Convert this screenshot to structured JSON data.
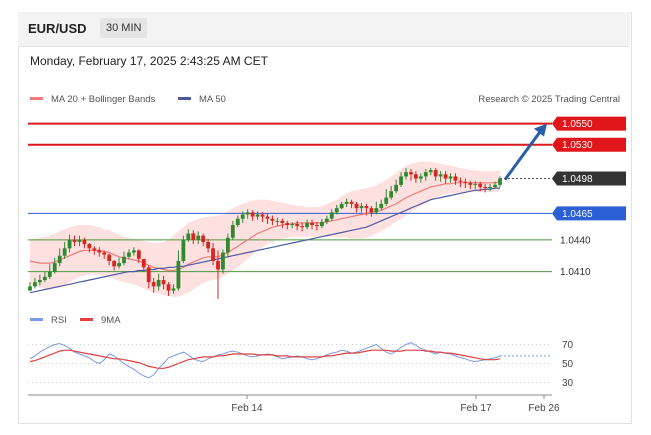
{
  "header": {
    "pair": "EUR/USD",
    "timeframe": "30 MIN"
  },
  "timestamp": "Monday, February 17, 2025 2:43:25 AM CET",
  "legend": {
    "ma20_label": "MA 20 + Bollinger Bands",
    "ma50_label": "MA 50",
    "copyright": "Research © 2025 Trading Central",
    "rsi_label": "RSI",
    "rsi_ma_label": "9MA"
  },
  "colors": {
    "resistance": "#e0161b",
    "current": "#333333",
    "support_strong": "#2a5fd6",
    "support": "#4a9a3b",
    "candle_up": "#2f8a2f",
    "candle_down": "#d8251f",
    "ma20": "#f07b7b",
    "ma50": "#4b5aa0",
    "band_fill": "#fde0e0",
    "arrow": "#2a5fa8",
    "rsi": "#7b9be0",
    "rsi_ma": "#e04040"
  },
  "chart_data": [
    {
      "type": "candlestick",
      "ylim": [
        1.0385,
        1.056
      ],
      "x_ticks": [
        "Feb 14",
        "Feb 17",
        "Feb 26"
      ],
      "levels": [
        {
          "value": 1.055,
          "label": "1.0550",
          "kind": "resistance"
        },
        {
          "value": 1.053,
          "label": "1.0530",
          "kind": "resistance"
        },
        {
          "value": 1.0498,
          "label": "1.0498",
          "kind": "current"
        },
        {
          "value": 1.0465,
          "label": "1.0465",
          "kind": "support_strong"
        },
        {
          "value": 1.044,
          "label": "1.0440",
          "kind": "support"
        },
        {
          "value": 1.041,
          "label": "1.0410",
          "kind": "support"
        }
      ],
      "series": [
        {
          "name": "MA 20 + Bollinger Bands"
        },
        {
          "name": "MA 50"
        }
      ],
      "close": [
        1.0396,
        1.04,
        1.0402,
        1.0405,
        1.041,
        1.0418,
        1.0425,
        1.0432,
        1.044,
        1.0438,
        1.044,
        1.0436,
        1.0432,
        1.043,
        1.0428,
        1.0426,
        1.042,
        1.0415,
        1.0418,
        1.0424,
        1.0428,
        1.043,
        1.0422,
        1.0414,
        1.04,
        1.0396,
        1.0402,
        1.0398,
        1.0392,
        1.0394,
        1.042,
        1.044,
        1.0446,
        1.044,
        1.0444,
        1.0438,
        1.0432,
        1.042,
        1.0412,
        1.0428,
        1.0442,
        1.0454,
        1.046,
        1.0464,
        1.0466,
        1.0462,
        1.0464,
        1.0462,
        1.046,
        1.0458,
        1.0458,
        1.0456,
        1.0454,
        1.0455,
        1.0453,
        1.0452,
        1.0456,
        1.0454,
        1.0453,
        1.0457,
        1.046,
        1.0466,
        1.047,
        1.0474,
        1.0476,
        1.0474,
        1.047,
        1.0472,
        1.047,
        1.0466,
        1.047,
        1.0474,
        1.048,
        1.0486,
        1.0492,
        1.05,
        1.0504,
        1.0502,
        1.0498,
        1.05,
        1.0504,
        1.0506,
        1.05,
        1.0502,
        1.0498,
        1.05,
        1.0496,
        1.0495,
        1.0494,
        1.0492,
        1.0493,
        1.049,
        1.0489,
        1.049,
        1.0492,
        1.0498
      ],
      "high": [
        1.04,
        1.0404,
        1.0407,
        1.041,
        1.0417,
        1.0423,
        1.0432,
        1.0438,
        1.0445,
        1.0444,
        1.0444,
        1.0442,
        1.0437,
        1.0434,
        1.0433,
        1.043,
        1.0427,
        1.0421,
        1.0423,
        1.0429,
        1.0431,
        1.0433,
        1.0431,
        1.0421,
        1.0416,
        1.0404,
        1.0408,
        1.0406,
        1.04,
        1.0398,
        1.043,
        1.0444,
        1.045,
        1.0449,
        1.0448,
        1.0446,
        1.0441,
        1.0437,
        1.043,
        1.0431,
        1.0446,
        1.0458,
        1.0463,
        1.0467,
        1.0469,
        1.0468,
        1.0467,
        1.0466,
        1.0465,
        1.0463,
        1.0461,
        1.046,
        1.0458,
        1.0457,
        1.0458,
        1.0456,
        1.0459,
        1.0459,
        1.0457,
        1.046,
        1.0463,
        1.0469,
        1.0473,
        1.0476,
        1.0479,
        1.0478,
        1.0476,
        1.0475,
        1.0474,
        1.0472,
        1.0476,
        1.0478,
        1.0488,
        1.0491,
        1.0497,
        1.0504,
        1.0508,
        1.0507,
        1.0505,
        1.0503,
        1.0507,
        1.0508,
        1.0508,
        1.0505,
        1.0505,
        1.0503,
        1.0503,
        1.0499,
        1.0498,
        1.0496,
        1.0496,
        1.0495,
        1.0493,
        1.0493,
        1.0495,
        1.05
      ],
      "low": [
        1.0392,
        1.0394,
        1.0397,
        1.04,
        1.0403,
        1.0408,
        1.0415,
        1.0422,
        1.0428,
        1.0434,
        1.0434,
        1.0432,
        1.0428,
        1.0426,
        1.0424,
        1.0422,
        1.0416,
        1.0411,
        1.0413,
        1.0416,
        1.0422,
        1.0425,
        1.0418,
        1.041,
        1.0394,
        1.039,
        1.0392,
        1.0393,
        1.0387,
        1.0389,
        1.0392,
        1.0418,
        1.0438,
        1.0436,
        1.0436,
        1.0434,
        1.0428,
        1.0416,
        1.0384,
        1.0408,
        1.0424,
        1.044,
        1.0452,
        1.0456,
        1.046,
        1.0458,
        1.0459,
        1.0457,
        1.0455,
        1.0454,
        1.0453,
        1.0451,
        1.045,
        1.0451,
        1.0449,
        1.0448,
        1.045,
        1.045,
        1.0449,
        1.0451,
        1.0455,
        1.0458,
        1.0464,
        1.0469,
        1.0471,
        1.047,
        1.0466,
        1.0466,
        1.0463,
        1.0462,
        1.0464,
        1.0468,
        1.0472,
        1.0478,
        1.0484,
        1.049,
        1.0497,
        1.0496,
        1.0494,
        1.0494,
        1.0496,
        1.0501,
        1.0496,
        1.0495,
        1.0493,
        1.0494,
        1.0492,
        1.049,
        1.0489,
        1.0488,
        1.0488,
        1.0486,
        1.0485,
        1.0486,
        1.0488,
        1.049
      ],
      "ma20": [
        1.042,
        1.0419,
        1.0418,
        1.0418,
        1.0418,
        1.0419,
        1.0421,
        1.0423,
        1.0425,
        1.0427,
        1.0429,
        1.043,
        1.043,
        1.043,
        1.043,
        1.0429,
        1.0428,
        1.0426,
        1.0424,
        1.0423,
        1.0422,
        1.0421,
        1.042,
        1.0418,
        1.0416,
        1.0414,
        1.0413,
        1.0412,
        1.0411,
        1.0411,
        1.0412,
        1.0414,
        1.0417,
        1.0419,
        1.0421,
        1.0423,
        1.0424,
        1.0424,
        1.0424,
        1.0426,
        1.0428,
        1.0431,
        1.0434,
        1.0437,
        1.044,
        1.0443,
        1.0446,
        1.0448,
        1.045,
        1.0452,
        1.0453,
        1.0454,
        1.0455,
        1.0455,
        1.0456,
        1.0456,
        1.0456,
        1.0456,
        1.0456,
        1.0456,
        1.0457,
        1.0458,
        1.0459,
        1.046,
        1.0461,
        1.0462,
        1.0463,
        1.0464,
        1.0465,
        1.0466,
        1.0467,
        1.0468,
        1.047,
        1.0472,
        1.0474,
        1.0477,
        1.048,
        1.0482,
        1.0484,
        1.0486,
        1.0488,
        1.049,
        1.0491,
        1.0492,
        1.0493,
        1.0493,
        1.0494,
        1.0494,
        1.0494,
        1.0494,
        1.0494,
        1.0494,
        1.0494,
        1.0494,
        1.0494,
        1.0495
      ],
      "bb_upper": [
        1.044,
        1.0441,
        1.0442,
        1.0443,
        1.0444,
        1.0446,
        1.0448,
        1.045,
        1.0452,
        1.0453,
        1.0454,
        1.0454,
        1.0454,
        1.0453,
        1.0452,
        1.045,
        1.0449,
        1.0447,
        1.0445,
        1.0443,
        1.0442,
        1.0441,
        1.044,
        1.0439,
        1.0438,
        1.0437,
        1.0437,
        1.0438,
        1.044,
        1.0444,
        1.0448,
        1.0452,
        1.0456,
        1.0458,
        1.046,
        1.0461,
        1.0462,
        1.0462,
        1.0463,
        1.0464,
        1.0467,
        1.047,
        1.0472,
        1.0474,
        1.0476,
        1.0477,
        1.0478,
        1.0478,
        1.0478,
        1.0477,
        1.0476,
        1.0475,
        1.0474,
        1.0473,
        1.0472,
        1.0472,
        1.0471,
        1.0471,
        1.0471,
        1.0472,
        1.0474,
        1.0476,
        1.0478,
        1.0481,
        1.0484,
        1.0486,
        1.0487,
        1.0488,
        1.0489,
        1.049,
        1.0492,
        1.0494,
        1.0497,
        1.05,
        1.0503,
        1.0507,
        1.051,
        1.0512,
        1.0513,
        1.0514,
        1.0514,
        1.0514,
        1.0513,
        1.0512,
        1.0511,
        1.051,
        1.0509,
        1.0508,
        1.0507,
        1.0506,
        1.0506,
        1.0505,
        1.0505,
        1.0505,
        1.0505,
        1.0506
      ],
      "bb_lower": [
        1.0398,
        1.0396,
        1.0395,
        1.0394,
        1.0394,
        1.0394,
        1.0395,
        1.0397,
        1.04,
        1.0403,
        1.0405,
        1.0406,
        1.0407,
        1.0407,
        1.0407,
        1.0406,
        1.0405,
        1.0403,
        1.0401,
        1.04,
        1.0399,
        1.0398,
        1.0396,
        1.0394,
        1.0392,
        1.039,
        1.0389,
        1.0388,
        1.0387,
        1.0386,
        1.0386,
        1.0388,
        1.039,
        1.0393,
        1.0396,
        1.0399,
        1.0401,
        1.0402,
        1.0403,
        1.0405,
        1.0408,
        1.0411,
        1.0414,
        1.0418,
        1.0422,
        1.0426,
        1.043,
        1.0433,
        1.0436,
        1.0438,
        1.044,
        1.0441,
        1.0442,
        1.0443,
        1.0443,
        1.0443,
        1.0443,
        1.0443,
        1.0443,
        1.0443,
        1.0443,
        1.0443,
        1.0443,
        1.0442,
        1.0442,
        1.0441,
        1.0441,
        1.0441,
        1.0442,
        1.0444,
        1.0446,
        1.0448,
        1.0451,
        1.0454,
        1.0457,
        1.046,
        1.0463,
        1.0466,
        1.0469,
        1.0472,
        1.0475,
        1.0478,
        1.048,
        1.0482,
        1.0483,
        1.0484,
        1.0484,
        1.0485,
        1.0485,
        1.0485,
        1.0485,
        1.0485,
        1.0485,
        1.0485,
        1.0485,
        1.0486
      ],
      "ma50": [
        1.039,
        1.0391,
        1.0392,
        1.0393,
        1.0394,
        1.0395,
        1.0396,
        1.0397,
        1.0398,
        1.0399,
        1.04,
        1.0401,
        1.0402,
        1.0403,
        1.0404,
        1.0405,
        1.0406,
        1.0407,
        1.0408,
        1.0409,
        1.041,
        1.041,
        1.0411,
        1.0411,
        1.0412,
        1.0412,
        1.0413,
        1.0413,
        1.0414,
        1.0414,
        1.0415,
        1.0415,
        1.0416,
        1.0417,
        1.0418,
        1.0419,
        1.042,
        1.0421,
        1.0422,
        1.0423,
        1.0424,
        1.0425,
        1.0426,
        1.0427,
        1.0428,
        1.0429,
        1.043,
        1.0431,
        1.0432,
        1.0433,
        1.0434,
        1.0435,
        1.0436,
        1.0437,
        1.0438,
        1.0439,
        1.044,
        1.0441,
        1.0442,
        1.0443,
        1.0444,
        1.0445,
        1.0446,
        1.0447,
        1.0448,
        1.0449,
        1.045,
        1.0451,
        1.0452,
        1.0454,
        1.0456,
        1.0458,
        1.046,
        1.0462,
        1.0464,
        1.0466,
        1.0468,
        1.047,
        1.0472,
        1.0474,
        1.0476,
        1.0478,
        1.0479,
        1.048,
        1.0481,
        1.0482,
        1.0483,
        1.0484,
        1.0485,
        1.0486,
        1.0487,
        1.0487,
        1.0488,
        1.0488,
        1.0489,
        1.0489
      ]
    },
    {
      "type": "line",
      "ylim": [
        20,
        80
      ],
      "y_ticks": [
        70,
        50,
        30
      ],
      "series": [
        {
          "name": "RSI",
          "values": [
            55,
            58,
            62,
            65,
            68,
            70,
            71,
            69,
            66,
            62,
            60,
            58,
            56,
            52,
            50,
            54,
            60,
            58,
            54,
            50,
            47,
            44,
            40,
            37,
            35,
            38,
            45,
            50,
            56,
            58,
            60,
            62,
            59,
            55,
            53,
            52,
            55,
            57,
            59,
            60,
            62,
            63,
            62,
            60,
            58,
            57,
            58,
            59,
            60,
            59,
            57,
            55,
            56,
            57,
            58,
            57,
            55,
            54,
            55,
            57,
            59,
            61,
            62,
            64,
            63,
            61,
            62,
            64,
            66,
            68,
            70,
            66,
            62,
            60,
            63,
            67,
            70,
            72,
            69,
            66,
            64,
            62,
            60,
            62,
            61,
            60,
            58,
            56,
            55,
            53,
            52,
            53,
            54,
            55,
            56,
            58
          ]
        },
        {
          "name": "9MA",
          "values": [
            52,
            53,
            55,
            57,
            59,
            61,
            63,
            64,
            64,
            63,
            62,
            61,
            60,
            59,
            58,
            57,
            56,
            55,
            55,
            54,
            53,
            52,
            51,
            49,
            47,
            46,
            45,
            45,
            46,
            48,
            50,
            52,
            54,
            55,
            56,
            57,
            57,
            57,
            58,
            58,
            59,
            60,
            60,
            60,
            60,
            60,
            59,
            59,
            59,
            59,
            58,
            58,
            58,
            57,
            57,
            57,
            57,
            57,
            57,
            57,
            58,
            58,
            59,
            60,
            61,
            61,
            61,
            62,
            63,
            64,
            64,
            64,
            64,
            63,
            63,
            63,
            64,
            64,
            64,
            64,
            63,
            63,
            62,
            62,
            61,
            61,
            60,
            59,
            58,
            57,
            56,
            55,
            54,
            54,
            54,
            55
          ]
        }
      ]
    }
  ]
}
